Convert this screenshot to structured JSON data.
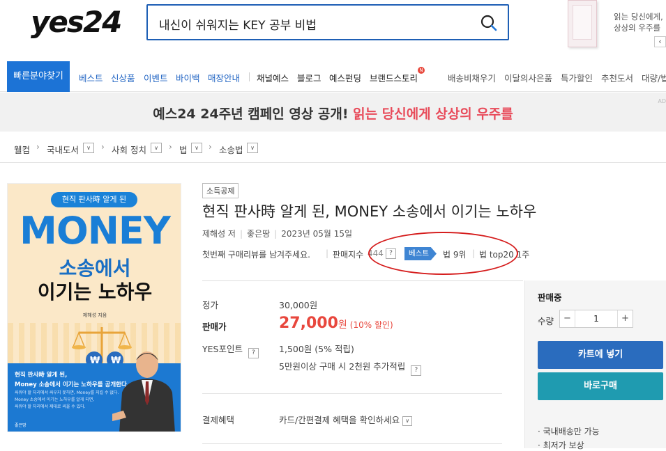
{
  "header": {
    "logo_text": "yes24",
    "search_value": "내신이 쉬워지는 KEY 공부 비법",
    "promo_line1": "읽는 당신에게,",
    "promo_line2": "상상의 우주를",
    "promo_prev": "‹"
  },
  "nav": {
    "quick": "빠른분야찾기",
    "items_blue": [
      "베스트",
      "신상품",
      "이벤트",
      "바이백",
      "매장안내"
    ],
    "items_dark": [
      "채널예스",
      "블로그",
      "예스펀딩",
      "브랜드스토리"
    ],
    "badge": "N",
    "items_gray": [
      "배송비채우기",
      "이달의사은품",
      "특가할인",
      "추천도서",
      "대량/법"
    ]
  },
  "banner": {
    "text_black": "예스24 24주년 캠페인 영상 공개!",
    "text_red": "읽는 당신에게 상상의 우주를",
    "ad": "AD"
  },
  "breadcrumb": [
    "웰컴",
    "국내도서",
    "사회 정치",
    "법",
    "소송법"
  ],
  "cover": {
    "tag": "현직 판사時 알게 된",
    "title1": "MONEY",
    "title2": "소송에서",
    "title3": "이기는 노하우",
    "author": "제해성 지음",
    "blurb1": "현직 판사時 알게 된,",
    "blurb2": "Money 소송에서 이기는 노하우를 공개한다.",
    "small1": "싸워야 할 자리에서 싸우지 못하면, Money를 지킬 수 없다.",
    "small2": "Money 소송에서 이기는 노하우를 알게 되면,",
    "small3": "싸워야 할 자리에서 제대로 싸울 수 있다.",
    "publisher": "좋은땅"
  },
  "book": {
    "tag": "소득공제",
    "title": "현직 판사時 알게 된, MONEY 소송에서 이기는 노하우",
    "author": "제해성 저",
    "publisher": "좋은땅",
    "date": "2023년 05월 15일",
    "review": "첫번째 구매리뷰를 남겨주세요.",
    "index_label": "판매지수",
    "index_value": "444",
    "help": "?",
    "best_label": "베스트",
    "rank1": "법 9위",
    "rank2": "법 top20 1주"
  },
  "price": {
    "list_label": "정가",
    "list_value": "30,000원",
    "sale_label": "판매가",
    "sale_num": "27,000",
    "sale_won": "원",
    "sale_disc": "(10% 할인)",
    "point_label": "YES포인트",
    "point_value": "1,500원 (5% 적립)",
    "extra_point": "5만원이상 구매 시 2천원 추가적립",
    "benefit_label": "결제혜택",
    "benefit_value": "카드/간편결제 혜택을 확인하세요",
    "dropdown": "∨"
  },
  "panel": {
    "status": "판매중",
    "qty_label": "수량",
    "qty_minus": "−",
    "qty_value": "1",
    "qty_plus": "+",
    "cart": "카트에 넣기",
    "buy": "바로구매",
    "note1": "· 국내배송만 가능",
    "note2": "· 최저가 보상"
  },
  "colors": {
    "brand_blue": "#1c73d6",
    "sale_red": "#e8473d",
    "cart_blue": "#2a6cbe",
    "buy_teal": "#1f9bb0",
    "annotation_red": "#d51c1c"
  }
}
